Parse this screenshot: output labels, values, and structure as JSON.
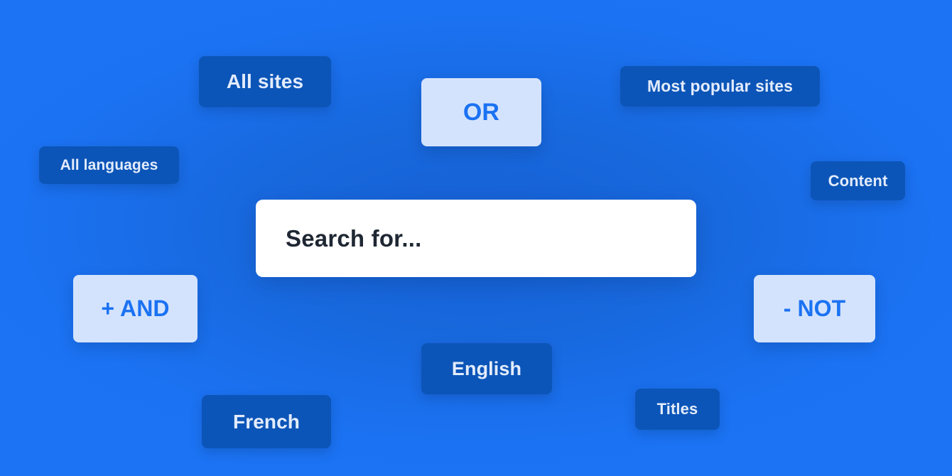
{
  "scene": {
    "background_color_outer": "#1b72f2",
    "background_color_inner": "#1660d4"
  },
  "search": {
    "placeholder": "Search for...",
    "value": "",
    "background_color": "#ffffff",
    "text_color": "#1f2733"
  },
  "filters": {
    "dark_pill_color": "#0c55b8",
    "dark_pill_text_color": "#e3ecfb",
    "light_pill_color": "#d4e3fd",
    "light_pill_text_color": "#1b72f2",
    "scope": [
      {
        "id": "all-sites",
        "label": "All sites",
        "style": "dark"
      },
      {
        "id": "most-popular-sites",
        "label": "Most popular sites",
        "style": "dark"
      },
      {
        "id": "content",
        "label": "Content",
        "style": "dark"
      },
      {
        "id": "titles",
        "label": "Titles",
        "style": "dark"
      }
    ],
    "languages": [
      {
        "id": "all-languages",
        "label": "All languages",
        "style": "dark"
      },
      {
        "id": "english",
        "label": "English",
        "style": "dark"
      },
      {
        "id": "french",
        "label": "French",
        "style": "dark"
      }
    ],
    "operators": [
      {
        "id": "or",
        "label": "OR",
        "style": "light"
      },
      {
        "id": "and",
        "label": "+ AND",
        "style": "light"
      },
      {
        "id": "not",
        "label": "- NOT",
        "style": "light"
      }
    ]
  }
}
